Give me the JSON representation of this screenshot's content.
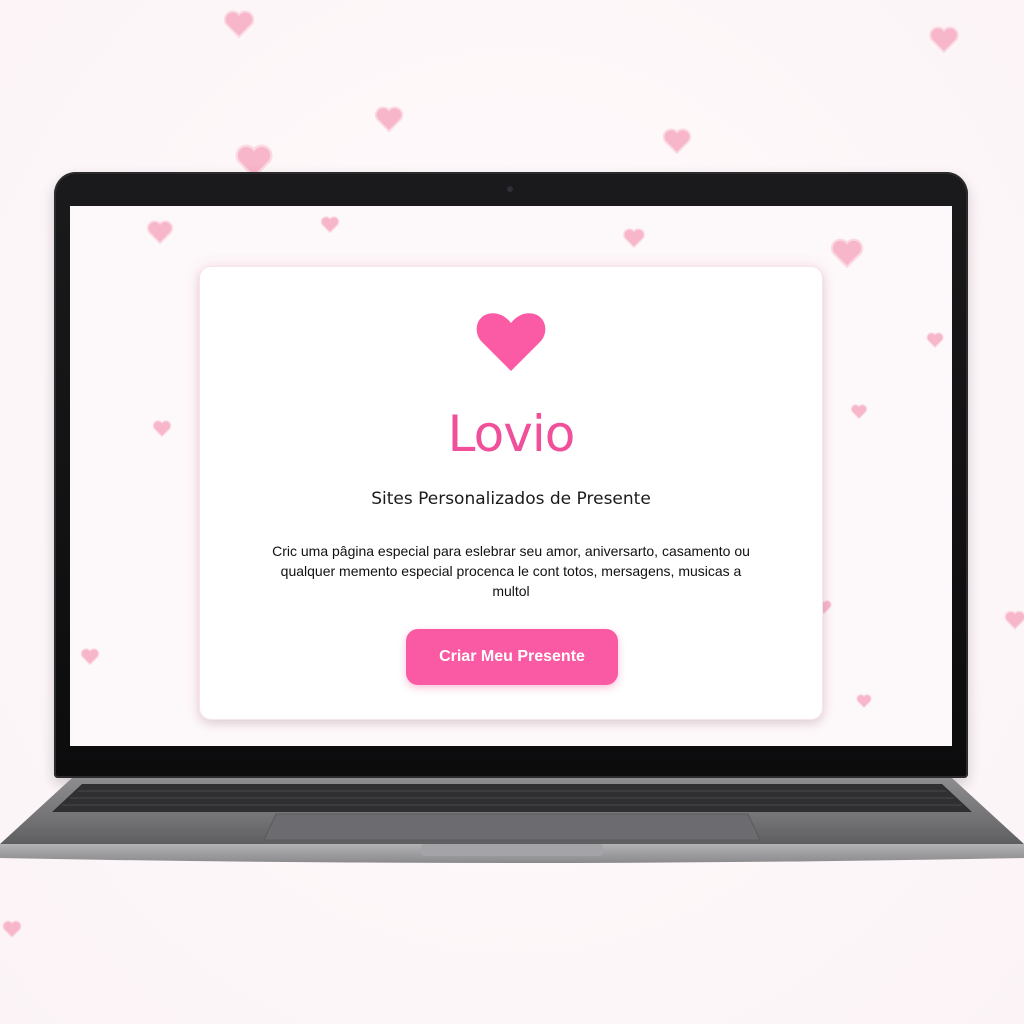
{
  "app": {
    "title": "Lovio",
    "subtitle": "Sites Personalizados de Presente",
    "description": "Cric uma pâgina especial para eslebrar seu amor, aniversarto, casamento ou qualquer memento especial procenca le cont totos, mersagens, musicas a multol",
    "cta_label": "Criar Meu Presente"
  },
  "colors": {
    "accent": "#f0509a",
    "button": "#fa5aa3",
    "floating_heart": "#f7b3c8",
    "background": "#fdf7f9"
  },
  "icons": {
    "main": "heart-icon",
    "decorative": "floating-heart-icon"
  }
}
